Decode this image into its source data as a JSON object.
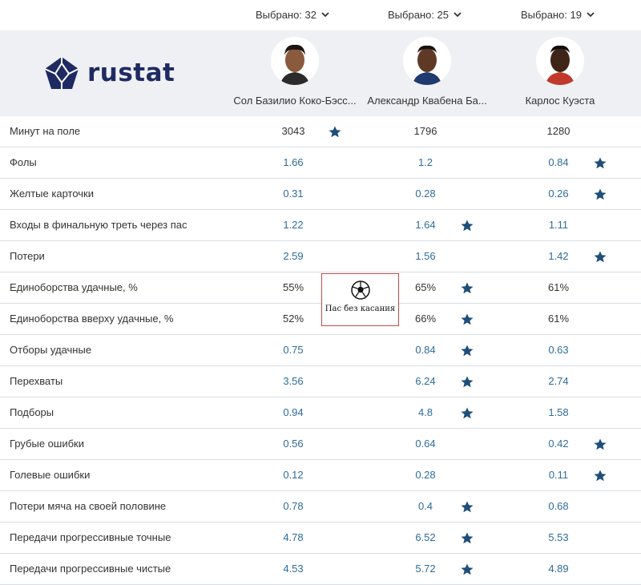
{
  "selectors": [
    {
      "label": "Выбрано: 32"
    },
    {
      "label": "Выбрано: 25"
    },
    {
      "label": "Выбрано: 19"
    }
  ],
  "logo": {
    "text": "rustat"
  },
  "players": [
    {
      "name": "Сол Базилио Коко-Бэсс..."
    },
    {
      "name": "Александр Квабена Ба..."
    },
    {
      "name": "Карлос Куэста"
    }
  ],
  "watermark": {
    "text": "Пас без касания"
  },
  "colors": {
    "link": "#2e6c9a",
    "star": "#1f4e79",
    "header_bg": "#eef0f3",
    "brand": "#1f2a62"
  },
  "stats": [
    {
      "label": "Минут на поле",
      "values": [
        "3043",
        "1796",
        "1280"
      ],
      "best": 0,
      "clickable": false
    },
    {
      "label": "Фолы",
      "values": [
        "1.66",
        "1.2",
        "0.84"
      ],
      "best": 2,
      "clickable": true
    },
    {
      "label": "Желтые карточки",
      "values": [
        "0.31",
        "0.28",
        "0.26"
      ],
      "best": 2,
      "clickable": true
    },
    {
      "label": "Входы в финальную треть через пас",
      "values": [
        "1.22",
        "1.64",
        "1.11"
      ],
      "best": 1,
      "clickable": true
    },
    {
      "label": "Потери",
      "values": [
        "2.59",
        "1.56",
        "1.42"
      ],
      "best": 2,
      "clickable": true
    },
    {
      "label": "Единоборства удачные, %",
      "values": [
        "55%",
        "65%",
        "61%"
      ],
      "best": 1,
      "clickable": false
    },
    {
      "label": "Единоборства вверху удачные, %",
      "values": [
        "52%",
        "66%",
        "61%"
      ],
      "best": 1,
      "clickable": false
    },
    {
      "label": "Отборы удачные",
      "values": [
        "0.75",
        "0.84",
        "0.63"
      ],
      "best": 1,
      "clickable": true
    },
    {
      "label": "Перехваты",
      "values": [
        "3.56",
        "6.24",
        "2.74"
      ],
      "best": 1,
      "clickable": true
    },
    {
      "label": "Подборы",
      "values": [
        "0.94",
        "4.8",
        "1.58"
      ],
      "best": 1,
      "clickable": true
    },
    {
      "label": "Грубые ошибки",
      "values": [
        "0.56",
        "0.64",
        "0.42"
      ],
      "best": 2,
      "clickable": true
    },
    {
      "label": "Голевые ошибки",
      "values": [
        "0.12",
        "0.28",
        "0.11"
      ],
      "best": 2,
      "clickable": true
    },
    {
      "label": "Потери мяча на своей половине",
      "values": [
        "0.78",
        "0.4",
        "0.68"
      ],
      "best": 1,
      "clickable": true
    },
    {
      "label": "Передачи прогрессивные точные",
      "values": [
        "4.78",
        "6.52",
        "5.53"
      ],
      "best": 1,
      "clickable": true
    },
    {
      "label": "Передачи прогрессивные чистые",
      "values": [
        "4.53",
        "5.72",
        "4.89"
      ],
      "best": 1,
      "clickable": true
    }
  ]
}
